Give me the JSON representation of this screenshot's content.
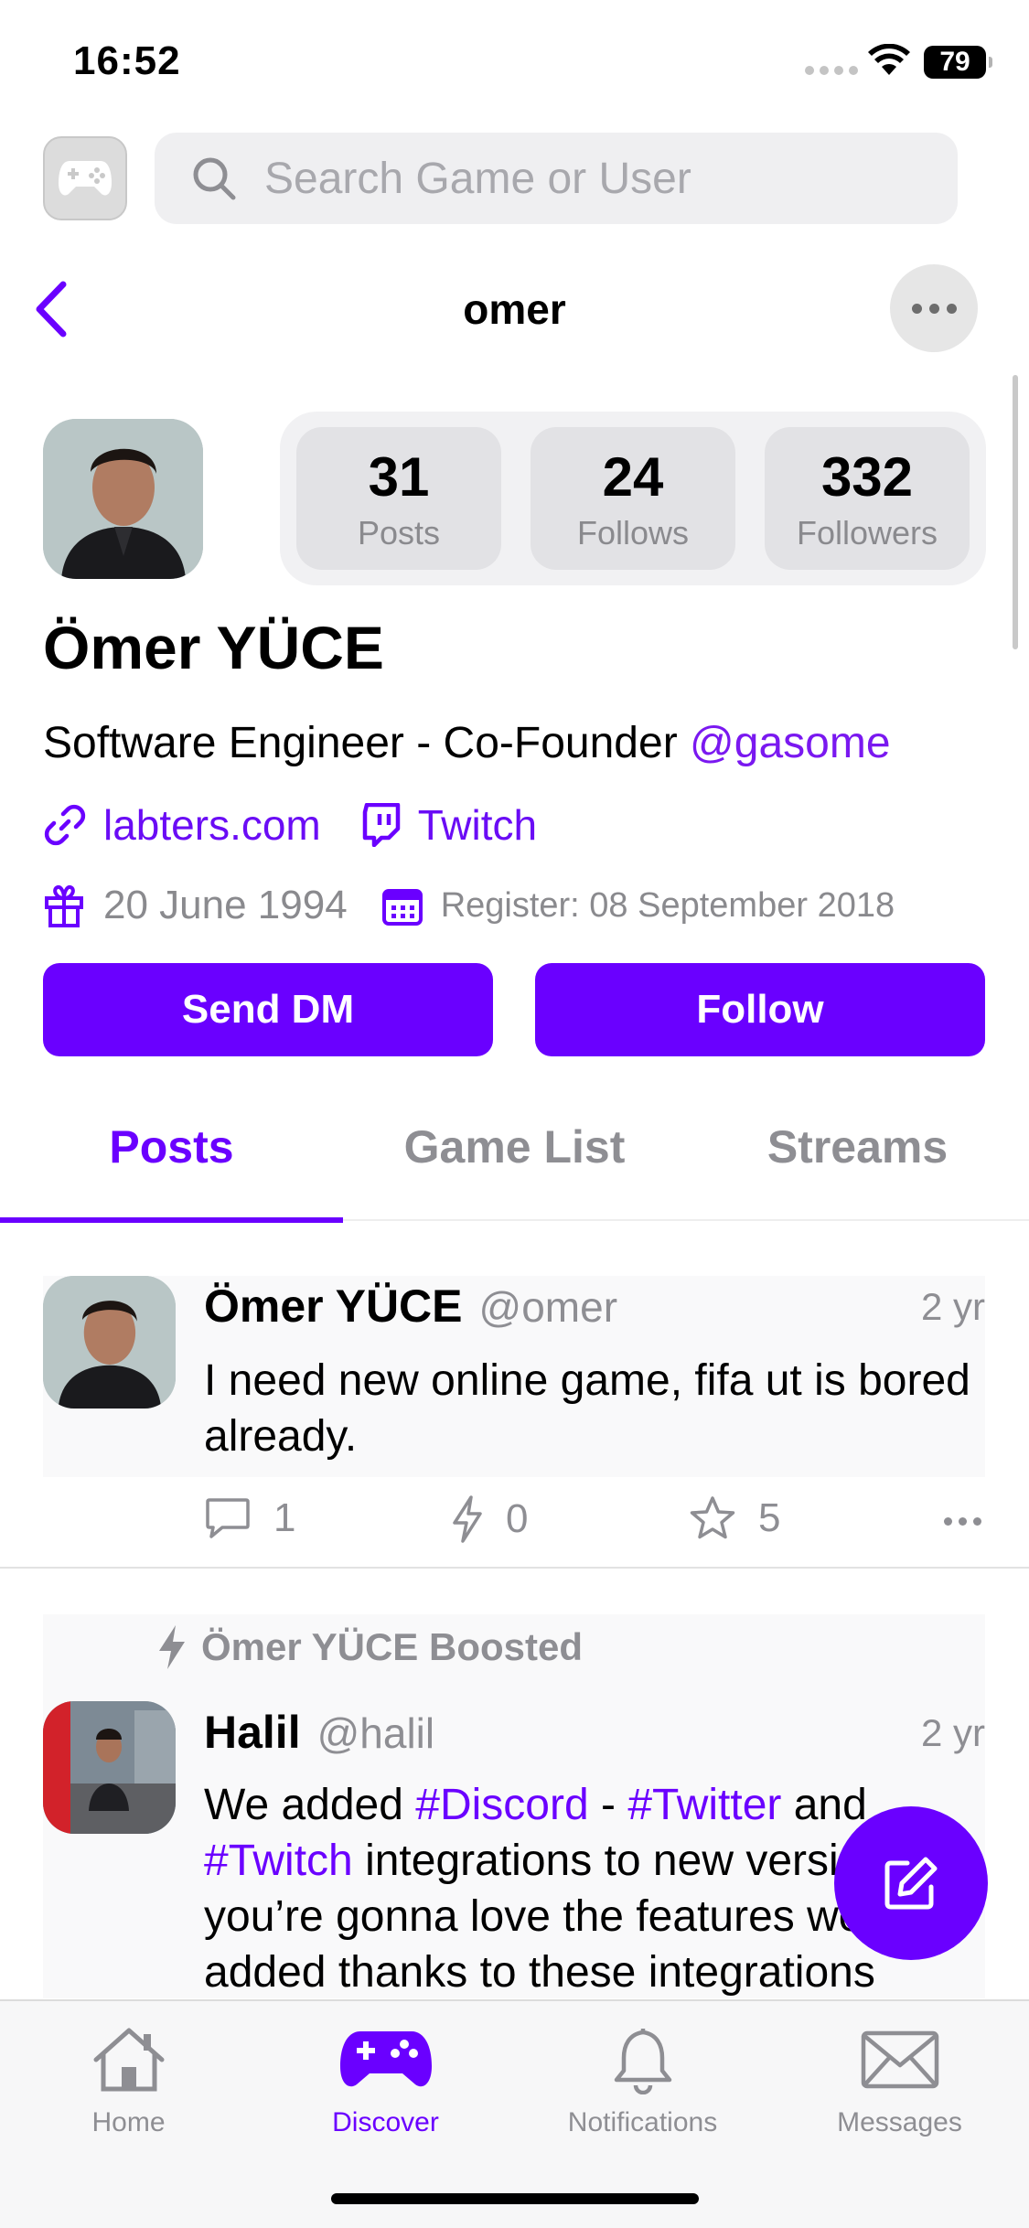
{
  "status_bar": {
    "time": "16:52",
    "battery": "79"
  },
  "search": {
    "placeholder": "Search Game or User"
  },
  "nav": {
    "title": "omer"
  },
  "profile": {
    "stats": [
      {
        "value": "31",
        "label": "Posts"
      },
      {
        "value": "24",
        "label": "Follows"
      },
      {
        "value": "332",
        "label": "Followers"
      }
    ],
    "name": "Ömer YÜCE",
    "bio_text": "Software Engineer - Co-Founder ",
    "bio_mention": "@gasome",
    "website": "labters.com",
    "twitch": "Twitch",
    "birthday": "20 June 1994",
    "register": "Register: 08 September 2018"
  },
  "buttons": {
    "send_dm": "Send DM",
    "follow": "Follow"
  },
  "tabs": [
    "Posts",
    "Game List",
    "Streams"
  ],
  "posts": [
    {
      "name": "Ömer YÜCE",
      "handle": "@omer",
      "time": "2 yr",
      "text": "I need new online game, fifa ut is bored already.",
      "comments": "1",
      "boosts": "0",
      "stars": "5"
    },
    {
      "boosted_by": "Ömer YÜCE Boosted",
      "name": "Halil",
      "handle": "@halil",
      "time": "2 yr",
      "text_parts": [
        "We added ",
        "#Discord",
        " - ",
        "#Twitter",
        " and ",
        "#Twitch",
        " integrations to new version, you’re gonna love the features we added thanks to these integrations"
      ]
    }
  ],
  "tab_bar": [
    "Home",
    "Discover",
    "Notifications",
    "Messages"
  ],
  "colors": {
    "accent": "#6a00ff",
    "secondary_text": "#8e8e93"
  }
}
